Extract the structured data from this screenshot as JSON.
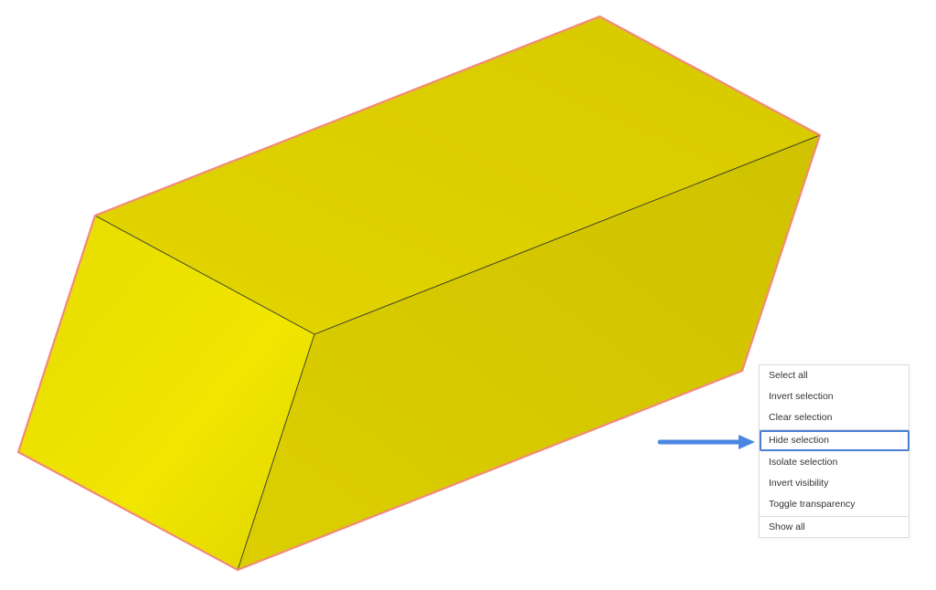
{
  "colors": {
    "face_left": "#eee400",
    "face_top": "#dccd00",
    "face_front": "#d5c800",
    "selection_outline": "#f28a7a",
    "edge": "#333333",
    "menu_highlight": "#4a7fd4",
    "arrow": "#4a86e0"
  },
  "context_menu": {
    "items": [
      {
        "label": "Select all"
      },
      {
        "label": "Invert selection"
      },
      {
        "label": "Clear selection"
      },
      {
        "label": "Hide selection"
      },
      {
        "label": "Isolate selection"
      },
      {
        "label": "Invert visibility"
      },
      {
        "label": "Toggle transparency"
      },
      {
        "label": "Show all"
      }
    ],
    "highlighted": "Hide selection"
  },
  "annotation": {
    "icon": "right-arrow-icon"
  }
}
